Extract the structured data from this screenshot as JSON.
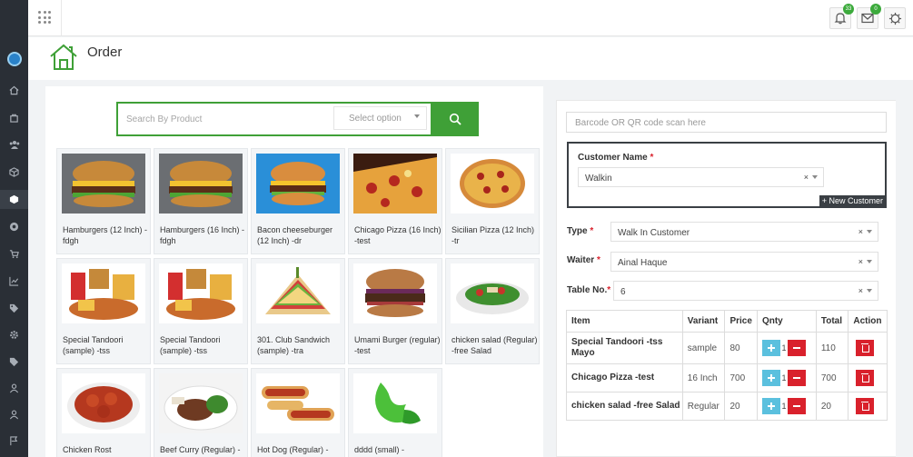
{
  "header": {
    "title": "Order",
    "notifications_count": "33",
    "messages_count": "0"
  },
  "search": {
    "placeholder": "Search By Product",
    "select_placeholder": "Select option"
  },
  "products": [
    {
      "name": "Hamburgers (12 Inch) -fdgh",
      "icon": "hamburger-image"
    },
    {
      "name": "Hamburgers (16 Inch) -fdgh",
      "icon": "hamburger-image"
    },
    {
      "name": "Bacon cheeseburger (12 Inch) -dr",
      "icon": "cheeseburger-image"
    },
    {
      "name": "Chicago Pizza (16 Inch) -test",
      "icon": "pizza-slice-image"
    },
    {
      "name": "Sicilian Pizza (12 Inch) -tr",
      "icon": "pizza-image"
    },
    {
      "name": "Special Tandoori (sample) -tss",
      "icon": "fast-food-image"
    },
    {
      "name": "Special Tandoori (sample) -tss",
      "icon": "fast-food-image"
    },
    {
      "name": "301. Club Sandwich (sample) -tra",
      "icon": "sandwich-image"
    },
    {
      "name": "Umami Burger (regular) -test",
      "icon": "burger-image"
    },
    {
      "name": "chicken salad (Regular) -free Salad",
      "icon": "salad-image"
    },
    {
      "name": "Chicken Rost",
      "icon": "chicken-image"
    },
    {
      "name": "Beef Curry (Regular) -",
      "icon": "beef-image"
    },
    {
      "name": "Hot Dog (Regular) -",
      "icon": "hotdog-image"
    },
    {
      "name": "dddd (small) -",
      "icon": "green-logo-image"
    }
  ],
  "order": {
    "barcode_placeholder": "Barcode OR QR code scan here",
    "customer_label": "Customer Name",
    "customer_value": "Walkin",
    "new_customer_label": "New Customer",
    "type_label": "Type",
    "type_value": "Walk In Customer",
    "waiter_label": "Waiter",
    "waiter_value": "Ainal Haque",
    "table_label": "Table No.",
    "table_value": "6",
    "required_mark": "*",
    "clear_mark": "×",
    "columns": [
      "Item",
      "Variant",
      "Price",
      "Qnty",
      "Total",
      "Action"
    ],
    "rows": [
      {
        "item": "Special Tandoori -tss Mayo",
        "variant": "sample",
        "price": "80",
        "qty": "1",
        "total": "110"
      },
      {
        "item": "Chicago Pizza -test",
        "variant": "16 Inch",
        "price": "700",
        "qty": "1",
        "total": "700"
      },
      {
        "item": "chicken salad -free Salad",
        "variant": "Regular",
        "price": "20",
        "qty": "1",
        "total": "20"
      }
    ]
  },
  "colors": {
    "accent_green": "#3fa037",
    "sidebar": "#2a2f36",
    "danger": "#d9212c",
    "info": "#5bc0de"
  }
}
